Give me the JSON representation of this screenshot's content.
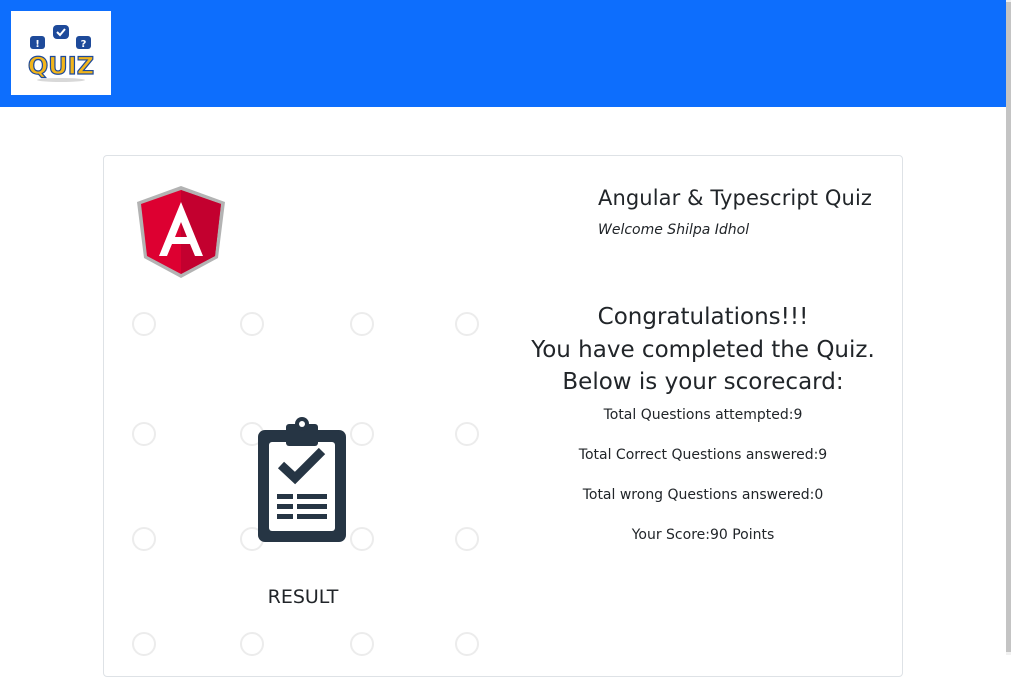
{
  "navbar": {
    "brand_color": "#0d6efd",
    "logo": {
      "icon": "quiz-logo",
      "text": "QUIZ"
    }
  },
  "card": {
    "angular_logo_icon": "angular-logo",
    "title": "Angular & Typescript Quiz",
    "welcome": "Welcome Shilpa Idhol",
    "congrats": {
      "line1": "Congratulations!!!",
      "line2": "You have completed the Quiz.",
      "line3": "Below is your scorecard:"
    },
    "stats": {
      "attempted": "Total Questions attempted:9",
      "correct": "Total Correct Questions answered:9",
      "wrong": "Total wrong Questions answered:0",
      "score": "Your Score:90 Points"
    },
    "result_icon": "clipboard-check-icon",
    "result_label": "RESULT"
  },
  "colors": {
    "angular_red": "#dd0031",
    "angular_dark_red": "#c3002f",
    "clipboard": "#263544"
  }
}
